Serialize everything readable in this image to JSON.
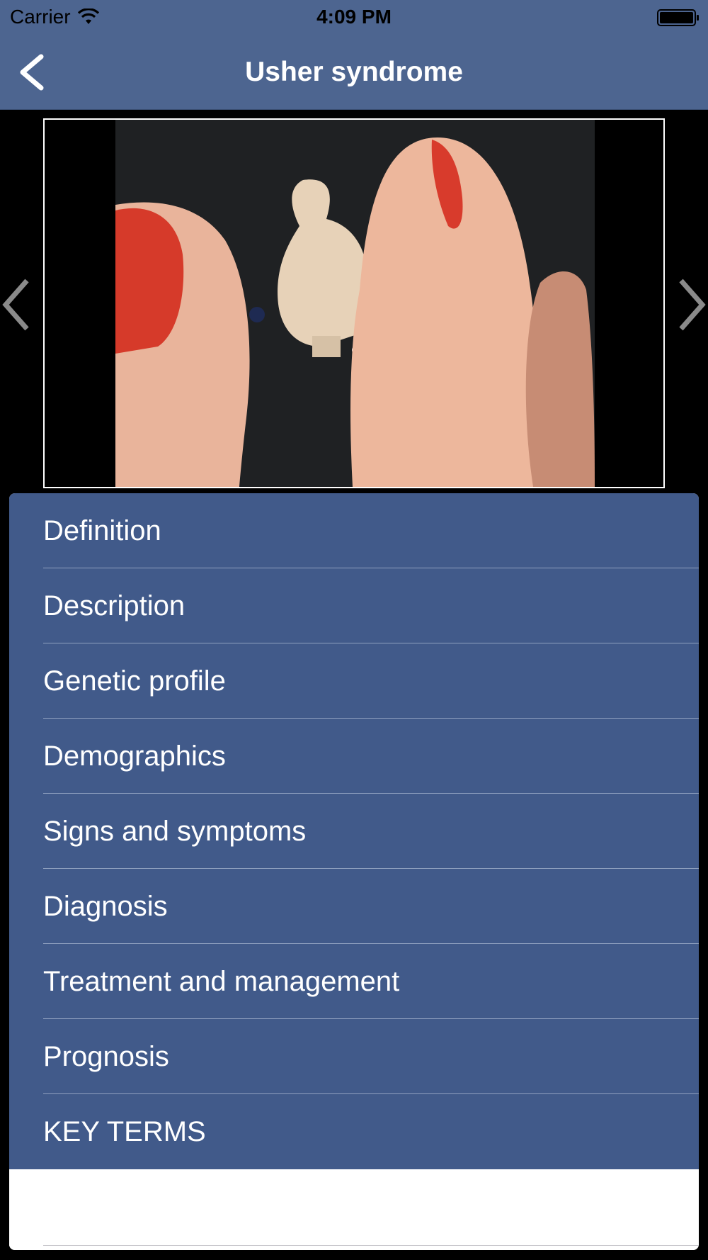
{
  "status_bar": {
    "carrier": "Carrier",
    "time": "4:09 PM",
    "wifi_icon": "wifi-icon",
    "battery_icon": "battery-icon"
  },
  "nav": {
    "title": "Usher syndrome",
    "back_icon": "chevron-left-icon"
  },
  "gallery": {
    "image_description": "hearing-aid-photo",
    "prev_icon": "chevron-left-icon",
    "next_icon": "chevron-right-icon"
  },
  "menu": {
    "items": [
      {
        "label": "Definition"
      },
      {
        "label": "Description"
      },
      {
        "label": "Genetic profile"
      },
      {
        "label": "Demographics"
      },
      {
        "label": "Signs and symptoms"
      },
      {
        "label": "Diagnosis"
      },
      {
        "label": "Treatment and management"
      },
      {
        "label": "Prognosis"
      },
      {
        "label": "KEY TERMS"
      }
    ]
  },
  "colors": {
    "nav_background": "#4d6590",
    "menu_background": "#415a8a",
    "text": "#ffffff"
  }
}
